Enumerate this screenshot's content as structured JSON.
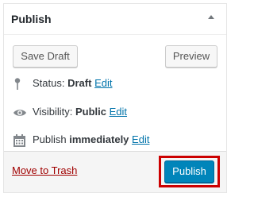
{
  "panel": {
    "title": "Publish",
    "toggle_icon": "arrow-up-icon"
  },
  "actions": {
    "save_draft_label": "Save Draft",
    "preview_label": "Preview"
  },
  "status": {
    "icon": "pin-icon",
    "label": "Status:",
    "value": "Draft",
    "edit_label": "Edit"
  },
  "visibility": {
    "icon": "eye-icon",
    "label": "Visibility:",
    "value": "Public",
    "edit_label": "Edit"
  },
  "schedule": {
    "icon": "calendar-icon",
    "label": "Publish",
    "value": "immediately",
    "edit_label": "Edit"
  },
  "footer": {
    "trash_label": "Move to Trash",
    "publish_label": "Publish"
  },
  "colors": {
    "link": "#0073aa",
    "trash": "#a00000",
    "primary": "#0085ba",
    "highlight": "#cc0000"
  }
}
